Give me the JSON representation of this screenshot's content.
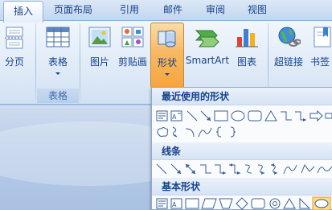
{
  "tabs": [
    {
      "label": "插入",
      "active": true
    },
    {
      "label": "页面布局",
      "active": false
    },
    {
      "label": "引用",
      "active": false
    },
    {
      "label": "邮件",
      "active": false
    },
    {
      "label": "审阅",
      "active": false
    },
    {
      "label": "视图",
      "active": false
    }
  ],
  "ribbon": {
    "page_break": "分页",
    "table": "表格",
    "table_group": "表格",
    "picture": "图片",
    "clipart": "剪贴画",
    "shapes": "形状",
    "smartart": "SmartArt",
    "chart": "图表",
    "hyperlink": "超链接",
    "bookmark": "书签"
  },
  "shapes_menu": {
    "recent": "最近使用的形状",
    "lines": "线条",
    "basic": "基本形状"
  },
  "colors": {
    "accent_orange": "#f6a43c",
    "ribbon_blue": "#15428b"
  }
}
